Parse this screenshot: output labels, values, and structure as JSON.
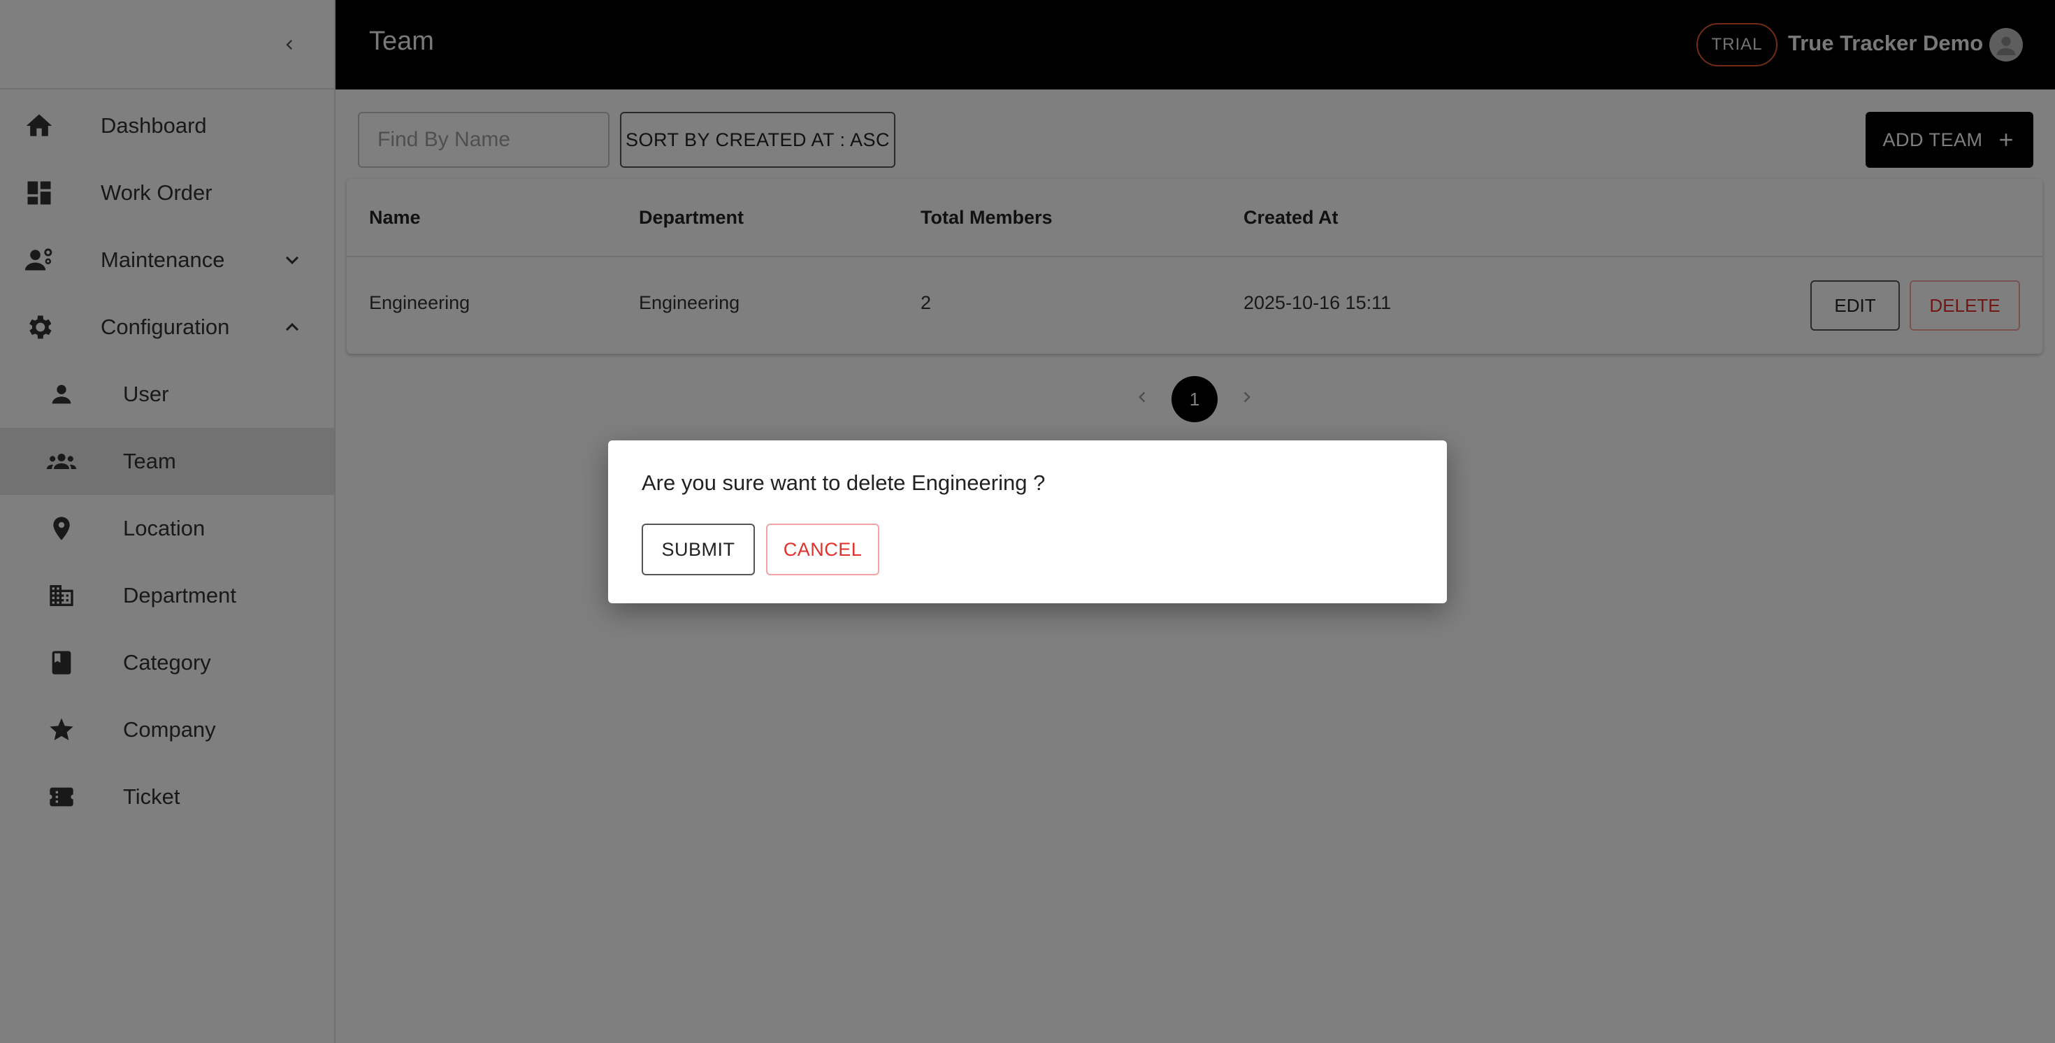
{
  "header": {
    "title": "Team",
    "trial_badge": "TRIAL",
    "company_name": "True Tracker Demo"
  },
  "sidebar": {
    "items": [
      {
        "label": "Dashboard",
        "icon": "home-icon"
      },
      {
        "label": "Work Order",
        "icon": "dashboard-icon"
      },
      {
        "label": "Maintenance",
        "icon": "engineering-icon",
        "expanded": false
      },
      {
        "label": "Configuration",
        "icon": "gear-icon",
        "expanded": true
      },
      {
        "label": "User",
        "icon": "person-icon"
      },
      {
        "label": "Team",
        "icon": "groups-icon",
        "active": true
      },
      {
        "label": "Location",
        "icon": "location-pin-icon"
      },
      {
        "label": "Department",
        "icon": "building-icon"
      },
      {
        "label": "Category",
        "icon": "book-icon"
      },
      {
        "label": "Company",
        "icon": "star-icon"
      },
      {
        "label": "Ticket",
        "icon": "ticket-icon"
      }
    ]
  },
  "toolbar": {
    "search_placeholder": "Find By Name",
    "sort_label": "SORT BY CREATED AT : ASC",
    "add_label": "ADD TEAM"
  },
  "table": {
    "columns": [
      "Name",
      "Department",
      "Total Members",
      "Created At"
    ],
    "rows": [
      {
        "name": "Engineering",
        "department": "Engineering",
        "total_members": "2",
        "created_at": "2025-10-16 15:11",
        "edit_label": "EDIT",
        "delete_label": "DELETE"
      }
    ]
  },
  "pagination": {
    "current_page": "1"
  },
  "dialog": {
    "message": "Are you sure want to delete Engineering ?",
    "submit_label": "SUBMIT",
    "cancel_label": "CANCEL"
  },
  "colors": {
    "header_bg": "#000000",
    "danger": "#e0312b",
    "trial_border": "#e4572e",
    "active_nav_bg": "#e4e4e4"
  }
}
